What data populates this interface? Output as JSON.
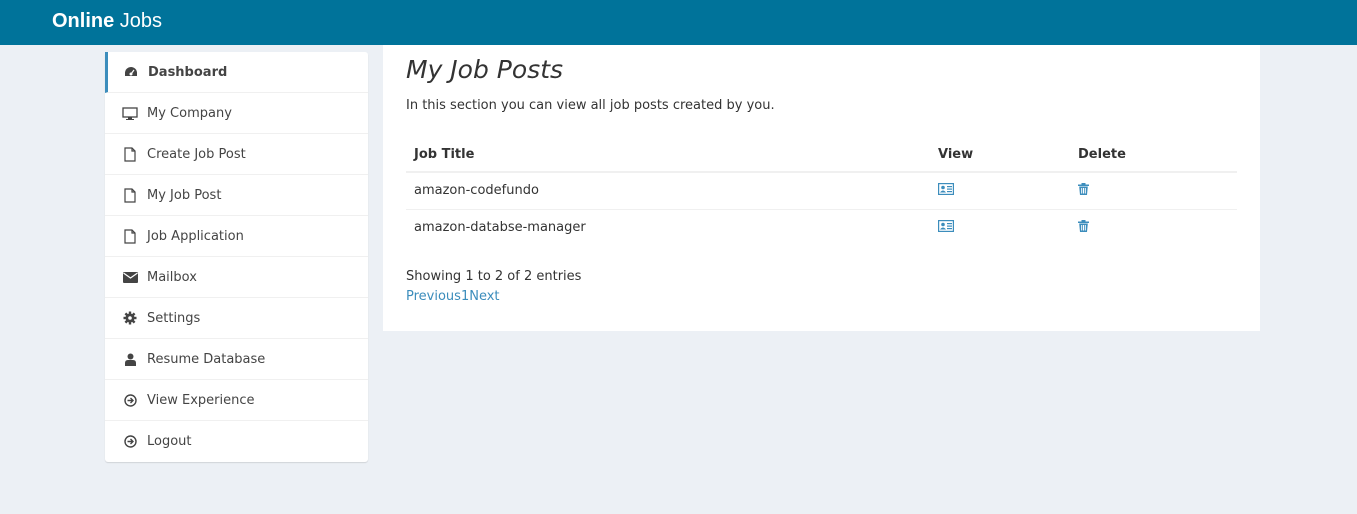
{
  "header": {
    "brand_bold": "Online",
    "brand_rest": " Jobs"
  },
  "sidebar": {
    "items": [
      {
        "label": "Dashboard",
        "icon": "dashboard-icon"
      },
      {
        "label": "My Company",
        "icon": "monitor-icon"
      },
      {
        "label": "Create Job Post",
        "icon": "file-icon"
      },
      {
        "label": "My Job Post",
        "icon": "file-icon"
      },
      {
        "label": "Job Application",
        "icon": "file-icon"
      },
      {
        "label": "Mailbox",
        "icon": "envelope-icon"
      },
      {
        "label": "Settings",
        "icon": "gear-icon"
      },
      {
        "label": "Resume Database",
        "icon": "user-icon"
      },
      {
        "label": "View Experience",
        "icon": "arrow-circle-icon"
      },
      {
        "label": "Logout",
        "icon": "arrow-circle-icon"
      }
    ]
  },
  "main": {
    "title": "My Job Posts",
    "description": "In this section you can view all job posts created by you.",
    "table": {
      "headers": [
        "Job Title",
        "View",
        "Delete"
      ],
      "rows": [
        {
          "title": "amazon-codefundo"
        },
        {
          "title": "amazon-databse-manager"
        }
      ]
    },
    "entries_info": "Showing 1 to 2 of 2 entries",
    "pagination": {
      "previous": "Previous",
      "page": "1",
      "next": "Next"
    }
  },
  "colors": {
    "header": "#00739a",
    "accent": "#3c8dbc",
    "background": "#ecf0f5"
  }
}
